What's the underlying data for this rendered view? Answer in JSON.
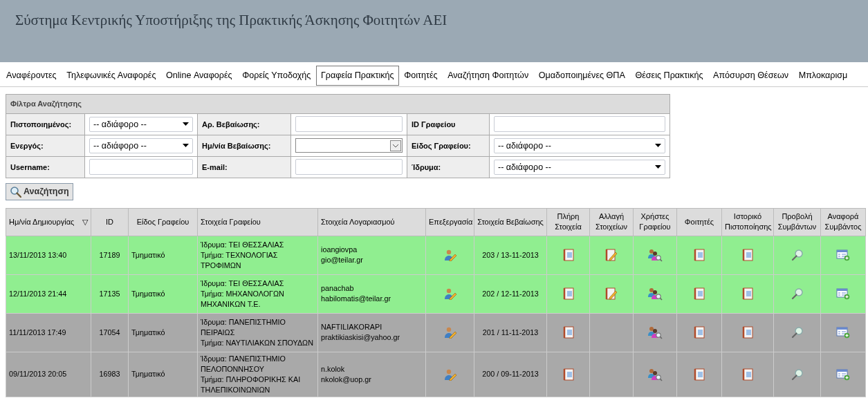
{
  "header": {
    "title": "Σύστημα Κεντρικής Υποστήριξης της Πρακτικής Άσκησης Φοιτητών ΑΕΙ"
  },
  "menu": [
    {
      "label": "Αναφέροντες",
      "selected": false
    },
    {
      "label": "Τηλεφωνικές Αναφορές",
      "selected": false
    },
    {
      "label": "Online Αναφορές",
      "selected": false
    },
    {
      "label": "Φορείς Υποδοχής",
      "selected": false
    },
    {
      "label": "Γραφεία Πρακτικής",
      "selected": true
    },
    {
      "label": "Φοιτητές",
      "selected": false
    },
    {
      "label": "Αναζήτηση Φοιτητών",
      "selected": false
    },
    {
      "label": "Ομαδοποιημένες ΘΠΑ",
      "selected": false
    },
    {
      "label": "Θέσεις Πρακτικής",
      "selected": false
    },
    {
      "label": "Απόσυρση Θέσεων",
      "selected": false
    },
    {
      "label": "Μπλοκαρισμ",
      "selected": false
    }
  ],
  "filters": {
    "title": "Φίλτρα Αναζήτησης",
    "rows": [
      [
        {
          "label": "Πιστοποιημένος:",
          "kind": "select",
          "value": "-- αδιάφορο --"
        },
        {
          "label": "Αρ. Βεβαίωσης:",
          "kind": "text"
        },
        {
          "label": "ID Γραφείου",
          "kind": "text"
        }
      ],
      [
        {
          "label": "Ενεργός:",
          "kind": "select",
          "value": "-- αδιάφορο --"
        },
        {
          "label": "Ημ/νία Βεβαίωσης:",
          "kind": "date"
        },
        {
          "label": "Είδος Γραφείου:",
          "kind": "select",
          "value": "-- αδιάφορο --"
        }
      ],
      [
        {
          "label": "Username:",
          "kind": "text"
        },
        {
          "label": "E-mail:",
          "kind": "text"
        },
        {
          "label": "Ίδρυμα:",
          "kind": "select",
          "value": "-- αδιάφορο --"
        }
      ]
    ],
    "search_button": "Αναζήτηση"
  },
  "table": {
    "columns": [
      {
        "label": "Ημ/νία Δημιουργίας",
        "sort": "▽"
      },
      {
        "label": "ID"
      },
      {
        "label": "Είδος Γραφείου"
      },
      {
        "label": "Στοιχεία Γραφείου"
      },
      {
        "label": "Στοιχεία Λογαριασμού"
      },
      {
        "label": "Επεξεργασία"
      },
      {
        "label": "Στοιχεία Βεβαίωσης"
      },
      {
        "label": "Πλήρη Στοιχεία"
      },
      {
        "label": "Αλλαγή Στοιχείων"
      },
      {
        "label": "Χρήστες Γραφείου"
      },
      {
        "label": "Φοιτητές"
      },
      {
        "label": "Ιστορικό Πιστοποίησης"
      },
      {
        "label": "Προβολή Συμβάντων"
      },
      {
        "label": "Αναφορά Συμβάντος"
      }
    ],
    "rows": [
      {
        "created": "13/11/2013 13:40",
        "id": "17189",
        "type": "Τμηματικό",
        "institution": "Ίδρυμα: ΤΕΙ ΘΕΣΣΑΛΙΑΣ",
        "department": "Τμήμα: ΤΕΧΝΟΛΟΓΙΑΣ ΤΡΟΦΙΜΩΝ",
        "username": "ioangiovpa",
        "email": "gio@teilar.gr",
        "certificate": "203 / 13-11-2013",
        "certified": true,
        "can_change": true
      },
      {
        "created": "12/11/2013 21:44",
        "id": "17135",
        "type": "Τμηματικό",
        "institution": "Ίδρυμα: ΤΕΙ ΘΕΣΣΑΛΙΑΣ",
        "department": "Τμήμα: ΜΗΧΑΝΟΛΟΓΩΝ ΜΗΧΑΝΙΚΩΝ Τ.Ε.",
        "username": "panachab",
        "email": "habilomatis@teilar.gr",
        "certificate": "202 / 12-11-2013",
        "certified": true,
        "can_change": true
      },
      {
        "created": "11/11/2013 17:49",
        "id": "17054",
        "type": "Τμηματικό",
        "institution": "Ίδρυμα: ΠΑΝΕΠΙΣΤΗΜΙΟ ΠΕΙΡΑΙΩΣ",
        "department": "Τμήμα: ΝΑΥΤΙΛΙΑΚΩΝ ΣΠΟΥΔΩΝ",
        "username": "NAFTILIAKORAPI",
        "email": "praktikiaskisi@yahoo.gr",
        "certificate": "201 / 11-11-2013",
        "certified": false,
        "can_change": false
      },
      {
        "created": "09/11/2013 20:05",
        "id": "16983",
        "type": "Τμηματικό",
        "institution": "Ίδρυμα: ΠΑΝΕΠΙΣΤΗΜΙΟ ΠΕΛΟΠΟΝΝΗΣΟΥ",
        "department": "Τμήμα: ΠΛΗΡΟΦΟΡΙΚΗΣ ΚΑΙ ΤΗΛΕΠΙΚΟΙΝΩΝΙΩΝ",
        "username": "n.kolok",
        "email": "nkolok@uop.gr",
        "certificate": "200 / 09-11-2013",
        "certified": false,
        "can_change": false
      }
    ]
  }
}
